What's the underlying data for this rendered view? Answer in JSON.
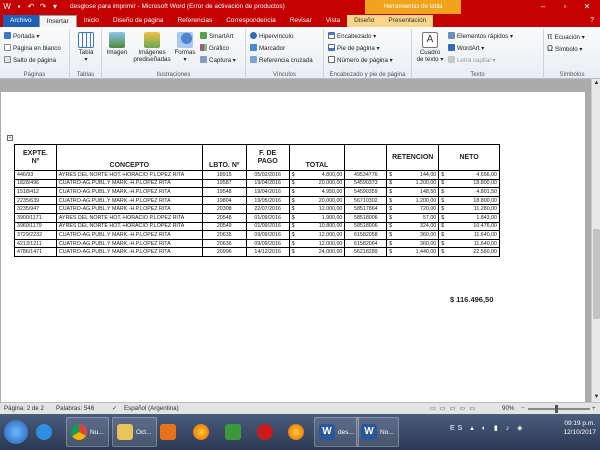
{
  "window": {
    "title": "desglose para imprimir - Microsoft Word (Error de activación de productos)",
    "context_tab_title": "Herramientas de tabla"
  },
  "tabs": [
    "Archivo",
    "Insertar",
    "Inicio",
    "Diseño de página",
    "Referencias",
    "Correspondencia",
    "Revisar",
    "Vista",
    "Diseño",
    "Presentación"
  ],
  "ribbon": {
    "paginas": {
      "name": "Páginas",
      "portada": "Portada",
      "pagina_en_blanco": "Página en blanco",
      "salto": "Salto de página"
    },
    "tablas": {
      "name": "Tablas",
      "tabla": "Tabla"
    },
    "ilustraciones": {
      "name": "Ilustraciones",
      "imagen": "Imagen",
      "imagenes_pre1": "Imágenes",
      "imagenes_pre2": "prediseñadas",
      "formas": "Formas",
      "smartart": "SmartArt",
      "grafico": "Gráfico",
      "captura": "Captura"
    },
    "vinculos": {
      "name": "Vínculos",
      "hipervinculo": "Hipervínculo",
      "marcador": "Marcador",
      "referencia": "Referencia cruzada"
    },
    "encabezado": {
      "name": "Encabezado y pie de página",
      "encabezado": "Encabezado",
      "pie": "Pie de página",
      "numero": "Número de página"
    },
    "texto": {
      "name": "Texto",
      "cuadro1": "Cuadro",
      "cuadro2": "de texto",
      "elementos": "Elementos rápidos",
      "wordart": "WordArt",
      "letra": "Letra capital"
    },
    "simbolos": {
      "name": "Símbolos",
      "ecuacion": "Ecuación",
      "simbolo": "Símbolo"
    }
  },
  "table": {
    "headers": {
      "expte1": "EXPTE.",
      "expte2": "Nº",
      "concepto": "CONCEPTO",
      "lbto": "LBTO. Nº",
      "fdepago1": "F. DE",
      "fdepago2": "PAGO",
      "total": "TOTAL",
      "blank": "",
      "retencion": "RETENCION",
      "neto": "NETO"
    },
    "rows": [
      {
        "expte": "446/93",
        "concepto": "AYRES DEL NORTE HOT.-HORACIO P.LOPEZ RITA",
        "lbto": "18915",
        "fecha": "05/02/2016",
        "total": "4.800,00",
        "codigo": "49534776",
        "retencion": "144,00",
        "neto": "4.656,00"
      },
      {
        "expte": "1828/496",
        "concepto": "CUATRO-AG.PUBL.Y MARK.-H.P.LOPEZ RITA",
        "lbto": "19587",
        "fecha": "19/04/2016",
        "total": "20.000,00",
        "codigo": "54590373",
        "retencion": "1.200,00",
        "neto": "18.800,00"
      },
      {
        "expte": "1518/412",
        "concepto": "CUATRO-AG.PUBL.Y MARK.-H.P.LOPEZ RITA",
        "lbto": "19548",
        "fecha": "19/04/2016",
        "total": "4.950,00",
        "codigo": "54590359",
        "retencion": "148,50",
        "neto": "4.801,50"
      },
      {
        "expte": "2235/639",
        "concepto": "CUATRO-AG.PUBL.Y MARK.-H.P.LOPEZ RITA",
        "lbto": "19804",
        "fecha": "19/05/2016",
        "total": "20.000,00",
        "codigo": "56710302",
        "retencion": "1.200,00",
        "neto": "18.800,00"
      },
      {
        "expte": "3235/947",
        "concepto": "CUATRO-AG.PUBL.Y MARK.-H.P.LOPEZ RITA",
        "lbto": "20308",
        "fecha": "22/07/2016",
        "total": "12.000,00",
        "codigo": "58517864",
        "retencion": "720,00",
        "neto": "11.280,00"
      },
      {
        "expte": "3900/1171",
        "concepto": "AYRES DEL NORTE HOT.-HORACIO P.LOPEZ RITA",
        "lbto": "20548",
        "fecha": "01/09/2016",
        "total": "1.900,00",
        "codigo": "58518006",
        "retencion": "57,00",
        "neto": "1.843,00"
      },
      {
        "expte": "3960/1179",
        "concepto": "AYRES DEL NORTE HOT.-HORACIO P.LOPEZ RITA",
        "lbto": "20549",
        "fecha": "01/09/2016",
        "total": "10.800,00",
        "codigo": "58518006",
        "retencion": "324,00",
        "neto": "10.476,00"
      },
      {
        "expte": "3729/2232",
        "concepto": "CUATRO-AG.PUBL.Y MARK.-H.P.LOPEZ RITA",
        "lbto": "20635",
        "fecha": "09/09/2016",
        "total": "12.000,00",
        "codigo": "61582058",
        "retencion": "360,00",
        "neto": "11.640,00"
      },
      {
        "expte": "4213/1211",
        "concepto": "CUATRO-AG.PUBL.Y MARK.-H.P.LOPEZ RITA",
        "lbto": "20636",
        "fecha": "09/09/2016",
        "total": "12.000,00",
        "codigo": "61582064",
        "retencion": "360,00",
        "neto": "11.640,00"
      },
      {
        "expte": "4786/1471",
        "concepto": "CUATRO-AG.PUBL.Y MARK.-H.P.LOPEZ RITA",
        "lbto": "20996",
        "fecha": "14/12/2016",
        "total": "24.000,00",
        "codigo": "56218289",
        "retencion": "1.440,00",
        "neto": "22.560,00"
      }
    ],
    "currency": "$",
    "grand_total": "$ 116.496,50"
  },
  "statusbar": {
    "page": "Página: 2 de 2",
    "words": "Palabras: 546",
    "language": "Español (Argentina)",
    "zoom": "90%"
  },
  "taskbar": {
    "items": [
      "Nu...",
      "Oct...",
      "des...",
      "No..."
    ],
    "lang": "ES",
    "time": "09:19 p.m.",
    "date": "12/10/2017"
  },
  "colors": {
    "titlebar": "#c40000",
    "file_tab": "#1f5fb5",
    "context": "#f2a31c"
  }
}
